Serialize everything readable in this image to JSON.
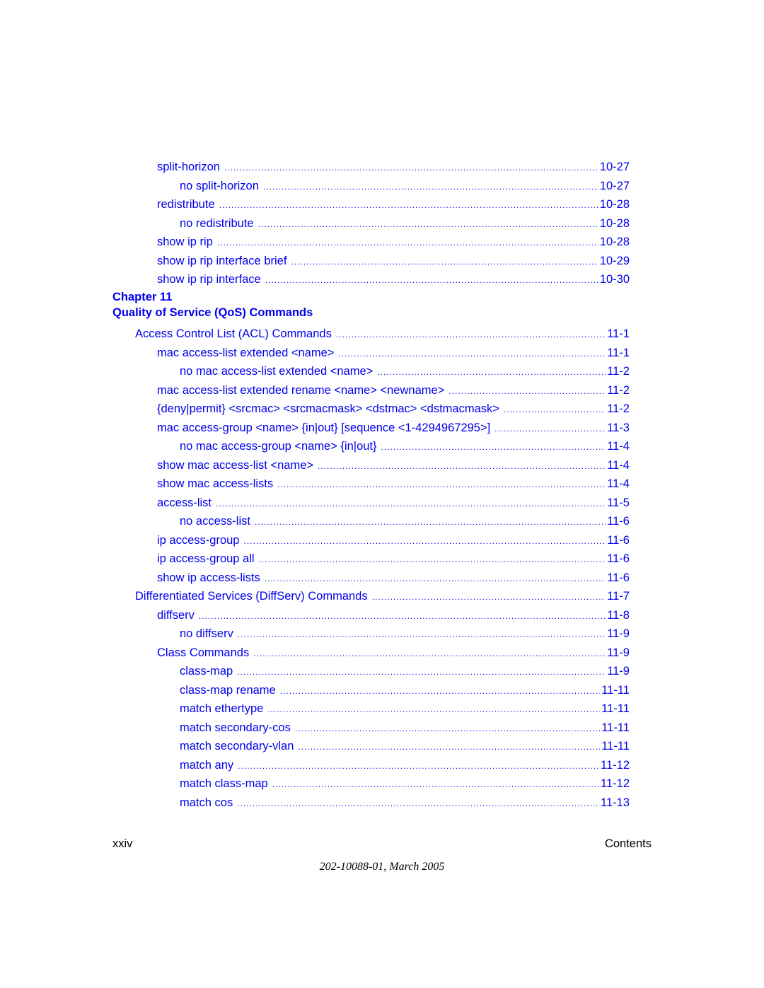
{
  "colors": {
    "link": "#0000ee",
    "text": "#000000",
    "background": "#ffffff"
  },
  "toc_top": [
    {
      "level": 1,
      "label": "split-horizon",
      "page": "10-27"
    },
    {
      "level": 2,
      "label": "no split-horizon",
      "page": "10-27"
    },
    {
      "level": 1,
      "label": "redistribute",
      "page": "10-28"
    },
    {
      "level": 2,
      "label": "no redistribute",
      "page": "10-28"
    },
    {
      "level": 1,
      "label": "show ip rip",
      "page": "10-28"
    },
    {
      "level": 1,
      "label": "show ip rip interface brief",
      "page": "10-29"
    },
    {
      "level": 1,
      "label": "show ip rip interface",
      "page": "10-30"
    }
  ],
  "chapter": {
    "number_label": "Chapter 11",
    "title": "Quality of Service (QoS) Commands"
  },
  "toc_chapter": [
    {
      "level": 0,
      "label": "Access Control List (ACL) Commands",
      "page": "11-1"
    },
    {
      "level": 1,
      "label": "mac access-list extended <name>",
      "page": "11-1"
    },
    {
      "level": 2,
      "label": "no mac access-list extended <name>",
      "page": "11-2"
    },
    {
      "level": 1,
      "label": "mac access-list extended rename <name> <newname>",
      "page": "11-2"
    },
    {
      "level": 1,
      "label": "{deny|permit} <srcmac> <srcmacmask> <dstmac> <dstmacmask>",
      "page": "11-2"
    },
    {
      "level": 1,
      "label": "mac access-group <name> {in|out} [sequence <1-4294967295>]",
      "page": "11-3"
    },
    {
      "level": 2,
      "label": "no mac access-group <name> {in|out}",
      "page": "11-4"
    },
    {
      "level": 1,
      "label": "show mac access-list <name>",
      "page": "11-4"
    },
    {
      "level": 1,
      "label": "show mac access-lists",
      "page": "11-4"
    },
    {
      "level": 1,
      "label": "access-list",
      "page": "11-5"
    },
    {
      "level": 2,
      "label": "no access-list",
      "page": "11-6"
    },
    {
      "level": 1,
      "label": "ip access-group",
      "page": "11-6"
    },
    {
      "level": 1,
      "label": "ip access-group all",
      "page": "11-6"
    },
    {
      "level": 1,
      "label": "show ip access-lists",
      "page": "11-6"
    },
    {
      "level": 0,
      "label": "Differentiated Services (DiffServ) Commands",
      "page": "11-7"
    },
    {
      "level": 1,
      "label": "diffserv",
      "page": "11-8"
    },
    {
      "level": 2,
      "label": "no diffserv",
      "page": "11-9"
    },
    {
      "level": 1,
      "label": "Class Commands",
      "page": "11-9"
    },
    {
      "level": 2,
      "label": "class-map",
      "page": "11-9"
    },
    {
      "level": 2,
      "label": "class-map rename",
      "page": "11-11"
    },
    {
      "level": 2,
      "label": "match ethertype",
      "page": "11-11"
    },
    {
      "level": 2,
      "label": "match secondary-cos",
      "page": "11-11"
    },
    {
      "level": 2,
      "label": "match secondary-vlan",
      "page": "11-11"
    },
    {
      "level": 2,
      "label": "match any",
      "page": "11-12"
    },
    {
      "level": 2,
      "label": "match class-map",
      "page": "11-12"
    },
    {
      "level": 2,
      "label": "match cos",
      "page": "11-13"
    }
  ],
  "footer": {
    "page_number": "xxiv",
    "section": "Contents",
    "doc_id": "202-10088-01, March 2005"
  }
}
